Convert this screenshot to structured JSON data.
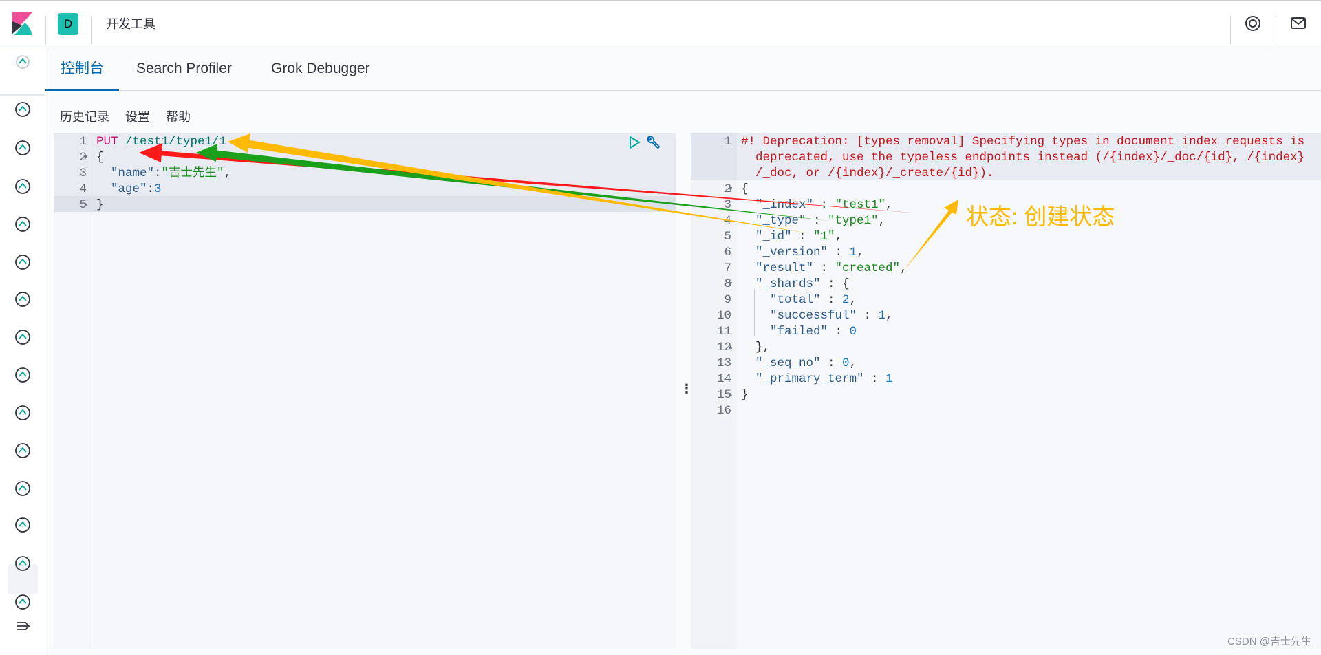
{
  "header": {
    "app_badge": "D",
    "app_title": "开发工具",
    "icons": [
      "help-lifebuoy-icon",
      "mail-icon"
    ]
  },
  "tabs": [
    {
      "label": "控制台",
      "active": true
    },
    {
      "label": "Search Profiler",
      "active": false
    },
    {
      "label": "Grok Debugger",
      "active": false
    }
  ],
  "toolbar": {
    "history": "历史记录",
    "settings": "设置",
    "help": "帮助"
  },
  "sidebar": {
    "icons": [
      "clock-icon",
      "discover-compass-icon",
      "visualize-chart-icon",
      "dashboard-icon",
      "canvas-icon",
      "maps-icon",
      "ml-icon",
      "siem-icon",
      "graph-icon",
      "logs-icon",
      "uptime-icon",
      "apm-icon",
      "dev-tools-wrench-icon",
      "monitoring-heartbeat-icon",
      "management-gear-icon",
      "collapse-menu-icon"
    ],
    "active": "dev-tools-wrench-icon"
  },
  "request": {
    "lines": [
      {
        "n": "1",
        "tokens": [
          [
            "method",
            "PUT"
          ],
          [
            "punc",
            " "
          ],
          [
            "url",
            "/test1/type1/1"
          ]
        ]
      },
      {
        "n": "2",
        "fold": "down",
        "tokens": [
          [
            "punc",
            "{"
          ]
        ]
      },
      {
        "n": "3",
        "tokens": [
          [
            "punc",
            "  "
          ],
          [
            "key",
            "\"name\""
          ],
          [
            "punc",
            ":"
          ],
          [
            "str",
            "\"吉士先生\""
          ],
          [
            "punc",
            ","
          ]
        ]
      },
      {
        "n": "4",
        "tokens": [
          [
            "punc",
            "  "
          ],
          [
            "key",
            "\"age\""
          ],
          [
            "punc",
            ":"
          ],
          [
            "num",
            "3"
          ]
        ]
      },
      {
        "n": "5",
        "fold": "up",
        "tokens": [
          [
            "punc",
            "}"
          ]
        ]
      }
    ]
  },
  "response": {
    "lines": [
      {
        "n": "1",
        "wrap": [
          "#! Deprecation: [types removal] Specifying types in document index requests is",
          "deprecated, use the typeless endpoints instead (/{index}/_doc/{id}, /{index}",
          "/_doc, or /{index}/_create/{id})."
        ]
      },
      {
        "n": "2",
        "fold": "down",
        "tokens": [
          [
            "punc",
            "{"
          ]
        ]
      },
      {
        "n": "3",
        "tokens": [
          [
            "punc",
            "  "
          ],
          [
            "key",
            "\"_index\""
          ],
          [
            "punc",
            " : "
          ],
          [
            "str",
            "\"test1\""
          ],
          [
            "punc",
            ","
          ]
        ]
      },
      {
        "n": "4",
        "tokens": [
          [
            "punc",
            "  "
          ],
          [
            "key",
            "\"_type\""
          ],
          [
            "punc",
            " : "
          ],
          [
            "str",
            "\"type1\""
          ],
          [
            "punc",
            ","
          ]
        ]
      },
      {
        "n": "5",
        "tokens": [
          [
            "punc",
            "  "
          ],
          [
            "key",
            "\"_id\""
          ],
          [
            "punc",
            " : "
          ],
          [
            "str",
            "\"1\""
          ],
          [
            "punc",
            ","
          ]
        ]
      },
      {
        "n": "6",
        "tokens": [
          [
            "punc",
            "  "
          ],
          [
            "key",
            "\"_version\""
          ],
          [
            "punc",
            " : "
          ],
          [
            "num",
            "1"
          ],
          [
            "punc",
            ","
          ]
        ]
      },
      {
        "n": "7",
        "tokens": [
          [
            "punc",
            "  "
          ],
          [
            "key",
            "\"result\""
          ],
          [
            "punc",
            " : "
          ],
          [
            "str",
            "\"created\""
          ],
          [
            "punc",
            ","
          ]
        ]
      },
      {
        "n": "8",
        "fold": "down",
        "tokens": [
          [
            "punc",
            "  "
          ],
          [
            "key",
            "\"_shards\""
          ],
          [
            "punc",
            " : {"
          ]
        ]
      },
      {
        "n": "9",
        "tokens": [
          [
            "punc",
            "    "
          ],
          [
            "key",
            "\"total\""
          ],
          [
            "punc",
            " : "
          ],
          [
            "num",
            "2"
          ],
          [
            "punc",
            ","
          ]
        ]
      },
      {
        "n": "10",
        "tokens": [
          [
            "punc",
            "    "
          ],
          [
            "key",
            "\"successful\""
          ],
          [
            "punc",
            " : "
          ],
          [
            "num",
            "1"
          ],
          [
            "punc",
            ","
          ]
        ]
      },
      {
        "n": "11",
        "tokens": [
          [
            "punc",
            "    "
          ],
          [
            "key",
            "\"failed\""
          ],
          [
            "punc",
            " : "
          ],
          [
            "num",
            "0"
          ]
        ]
      },
      {
        "n": "12",
        "fold": "up",
        "tokens": [
          [
            "punc",
            "  },"
          ]
        ]
      },
      {
        "n": "13",
        "tokens": [
          [
            "punc",
            "  "
          ],
          [
            "key",
            "\"_seq_no\""
          ],
          [
            "punc",
            " : "
          ],
          [
            "num",
            "0"
          ],
          [
            "punc",
            ","
          ]
        ]
      },
      {
        "n": "14",
        "tokens": [
          [
            "punc",
            "  "
          ],
          [
            "key",
            "\"_primary_term\""
          ],
          [
            "punc",
            " : "
          ],
          [
            "num",
            "1"
          ]
        ]
      },
      {
        "n": "15",
        "fold": "up",
        "tokens": [
          [
            "punc",
            "}"
          ]
        ]
      },
      {
        "n": "16",
        "tokens": []
      }
    ]
  },
  "annotation": {
    "text": "状态: 创建状态",
    "arrow_colors": {
      "red": "#ff1a1a",
      "green": "#1aa01a",
      "yellow": "#ffba00"
    }
  },
  "watermark": "CSDN @吉士先生",
  "colors": {
    "accent": "#006bb4",
    "badge": "#1cbfb0",
    "warning": "#c4161c"
  }
}
